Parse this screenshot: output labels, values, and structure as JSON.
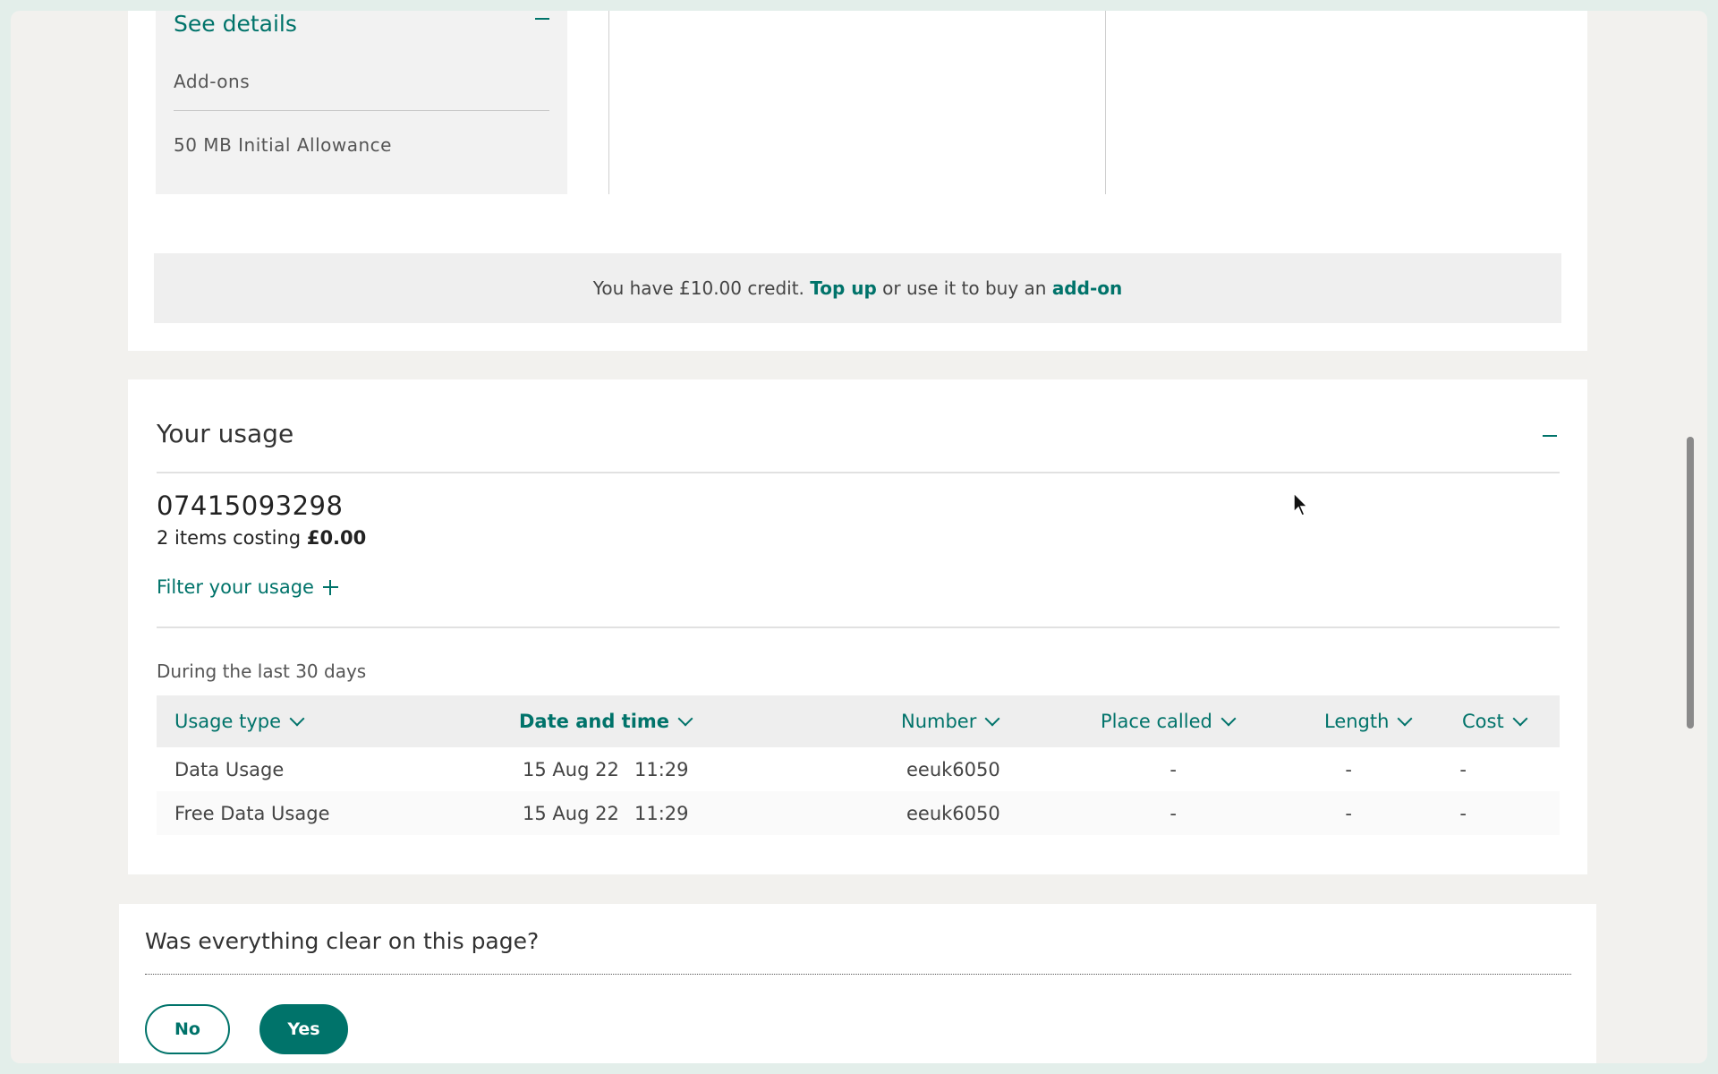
{
  "plan_details": {
    "see_details_label": "See details",
    "addons_label": "Add-ons",
    "allowance_label": "50 MB Initial Allowance"
  },
  "credit_banner": {
    "text_before": "You have £10.00 credit. ",
    "top_up_link": "Top up",
    "text_middle": " or use it to buy an ",
    "addon_link": "add-on"
  },
  "usage": {
    "title": "Your usage",
    "phone_number": "07415093298",
    "items_prefix": "2 items costing ",
    "items_cost": "£0.00",
    "filter_label": "Filter your usage",
    "period_label": "During the last 30 days",
    "columns": {
      "usage_type": "Usage type",
      "date_time": "Date and time",
      "number": "Number",
      "place_called": "Place called",
      "length": "Length",
      "cost": "Cost"
    },
    "rows": [
      {
        "usage_type": "Data Usage",
        "date": "15 Aug 22",
        "time": "11:29",
        "number": "eeuk6050",
        "place_called": "-",
        "length": "-",
        "cost": "-"
      },
      {
        "usage_type": "Free Data Usage",
        "date": "15 Aug 22",
        "time": "11:29",
        "number": "eeuk6050",
        "place_called": "-",
        "length": "-",
        "cost": "-"
      }
    ]
  },
  "feedback": {
    "question": "Was everything clear on this page?",
    "no_label": "No",
    "yes_label": "Yes"
  },
  "colors": {
    "accent": "#00736a",
    "page_background": "#f2f1ee"
  }
}
